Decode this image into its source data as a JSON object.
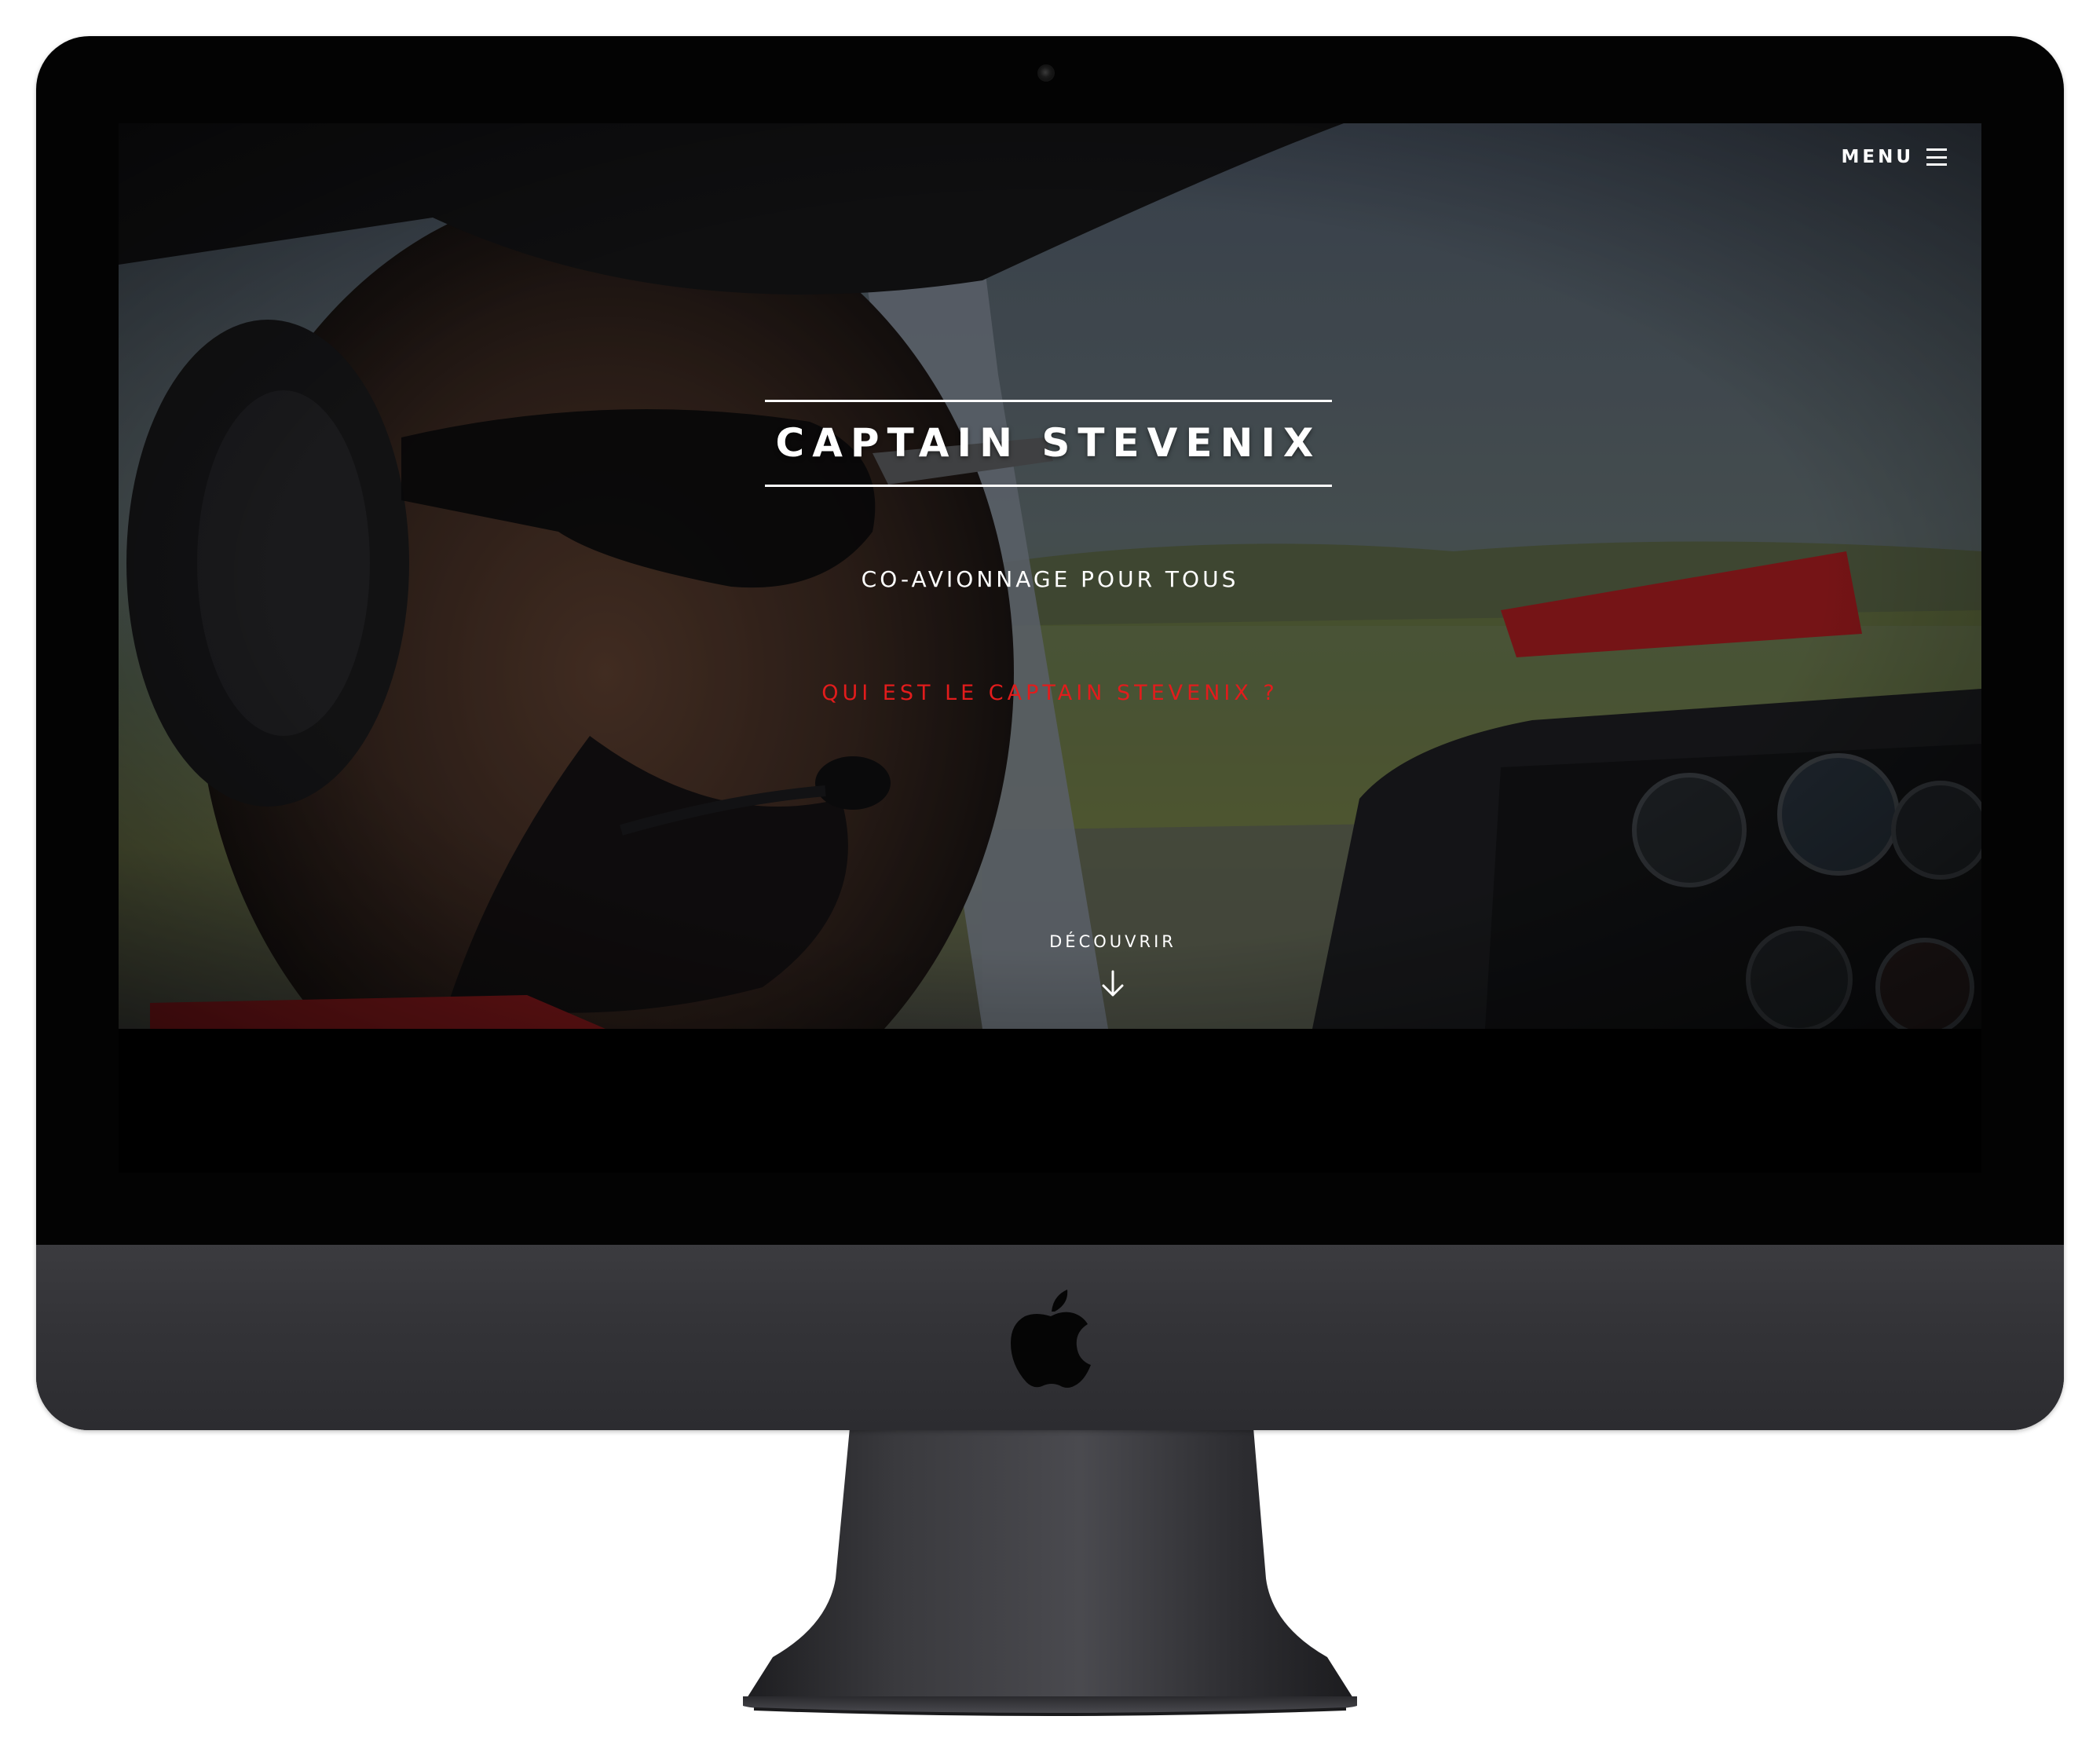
{
  "site": {
    "menu_label": "MENU",
    "title": "CAPTAIN STEVENIX",
    "subtitle": "CO-AVIONNAGE POUR TOUS",
    "cta_link": "QUI EST LE CAPTAIN STEVENIX ?",
    "discover_label": "DÉCOUVRIR"
  },
  "icons": {
    "menu": "hamburger-icon",
    "discover": "arrow-down-icon",
    "brand": "apple-logo"
  },
  "colors": {
    "accent": "#e21c1c",
    "text": "#ffffff",
    "bezel": "#030303",
    "chin": "#333337"
  }
}
